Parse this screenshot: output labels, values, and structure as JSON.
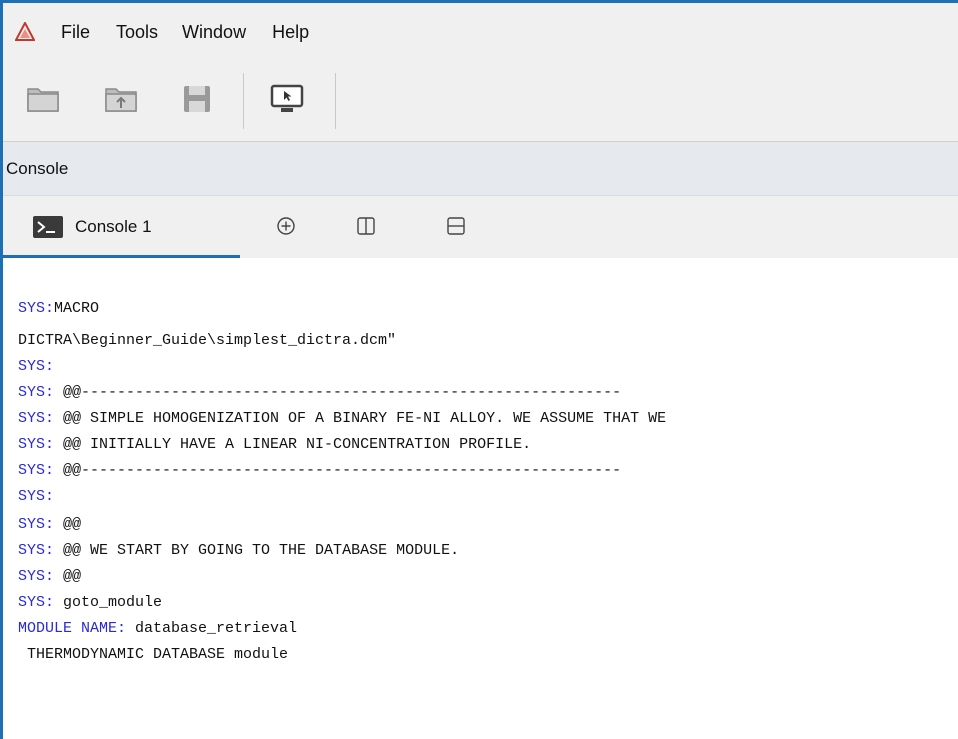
{
  "app": {
    "logo_icon": "app-logo-icon",
    "accent": "#1f6fb5"
  },
  "menu": [
    "File",
    "Tools",
    "Window",
    "Help"
  ],
  "toolbar": {
    "buttons": [
      {
        "name": "open-folder-button",
        "icon": "folder-icon"
      },
      {
        "name": "open-upload-button",
        "icon": "folder-upload-icon"
      },
      {
        "name": "save-button",
        "icon": "save-icon"
      },
      {
        "name": "console-screen-button",
        "icon": "monitor-cursor-icon"
      }
    ]
  },
  "console_panel": {
    "title": "Console"
  },
  "tabs": [
    {
      "label": "Console 1",
      "icon": "terminal-icon"
    }
  ],
  "tab_actions": [
    {
      "name": "add-console-button",
      "icon": "plus-circle-icon"
    },
    {
      "name": "split-vertical-button",
      "icon": "split-vertical-icon"
    },
    {
      "name": "split-horizontal-button",
      "icon": "split-horizontal-icon"
    }
  ],
  "console_lines": [
    {
      "prefix": "SYS:",
      "text": "MACRO"
    },
    {
      "prefix": "",
      "text": "DICTRA\\Beginner_Guide\\simplest_dictra.dcm\""
    },
    {
      "prefix": "SYS:",
      "text": ""
    },
    {
      "prefix": "SYS:",
      "text": " @@------------------------------------------------------------"
    },
    {
      "prefix": "SYS:",
      "text": " @@ SIMPLE HOMOGENIZATION OF A BINARY FE-NI ALLOY. WE ASSUME THAT WE"
    },
    {
      "prefix": "SYS:",
      "text": " @@ INITIALLY HAVE A LINEAR NI-CONCENTRATION PROFILE."
    },
    {
      "prefix": "SYS:",
      "text": " @@------------------------------------------------------------"
    },
    {
      "prefix": "SYS:",
      "text": ""
    },
    {
      "prefix": "SYS:",
      "text": " @@"
    },
    {
      "prefix": "SYS:",
      "text": " @@ WE START BY GOING TO THE DATABASE MODULE."
    },
    {
      "prefix": "SYS:",
      "text": " @@"
    },
    {
      "prefix": "SYS:",
      "text": " goto_module"
    },
    {
      "prefix": "MODULE NAME:",
      "text": " database_retrieval"
    },
    {
      "prefix": "",
      "text": " THERMODYNAMIC DATABASE module"
    }
  ]
}
